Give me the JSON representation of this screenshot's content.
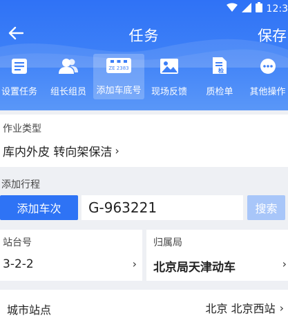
{
  "status_bar": {
    "time": "12:3"
  },
  "header": {
    "title": "任务",
    "save_label": "保存"
  },
  "toolbar": {
    "items": [
      {
        "label": "设置任务",
        "icon": "task-list-icon"
      },
      {
        "label": "组长组员",
        "icon": "group-members-icon"
      },
      {
        "label": "添加车底号",
        "icon": "train-number-icon",
        "badge": "ZE 2383",
        "active": true
      },
      {
        "label": "现场反馈",
        "icon": "image-icon"
      },
      {
        "label": "质检单",
        "icon": "inspection-form-icon"
      },
      {
        "label": "其他操作",
        "icon": "more-icon"
      }
    ]
  },
  "job_type": {
    "label": "作业类型",
    "value": "库内外皮 转向架保洁",
    "chevron": "›"
  },
  "itinerary": {
    "label": "添加行程",
    "add_train_button": "添加车次",
    "train_number": "G-963221",
    "search_button": "搜索"
  },
  "platform": {
    "label": "站台号",
    "value": "3-2-2",
    "chevron": "›"
  },
  "bureau": {
    "label": "归属局",
    "value": "北京局天津动车",
    "chevron": "›"
  },
  "city_station": {
    "label": "城市站点",
    "value": "北京 北京西站",
    "chevron": "›"
  },
  "colors": {
    "primary": "#2e73f5",
    "search_disabled": "#a8c6f9",
    "background": "#eef0f4"
  }
}
